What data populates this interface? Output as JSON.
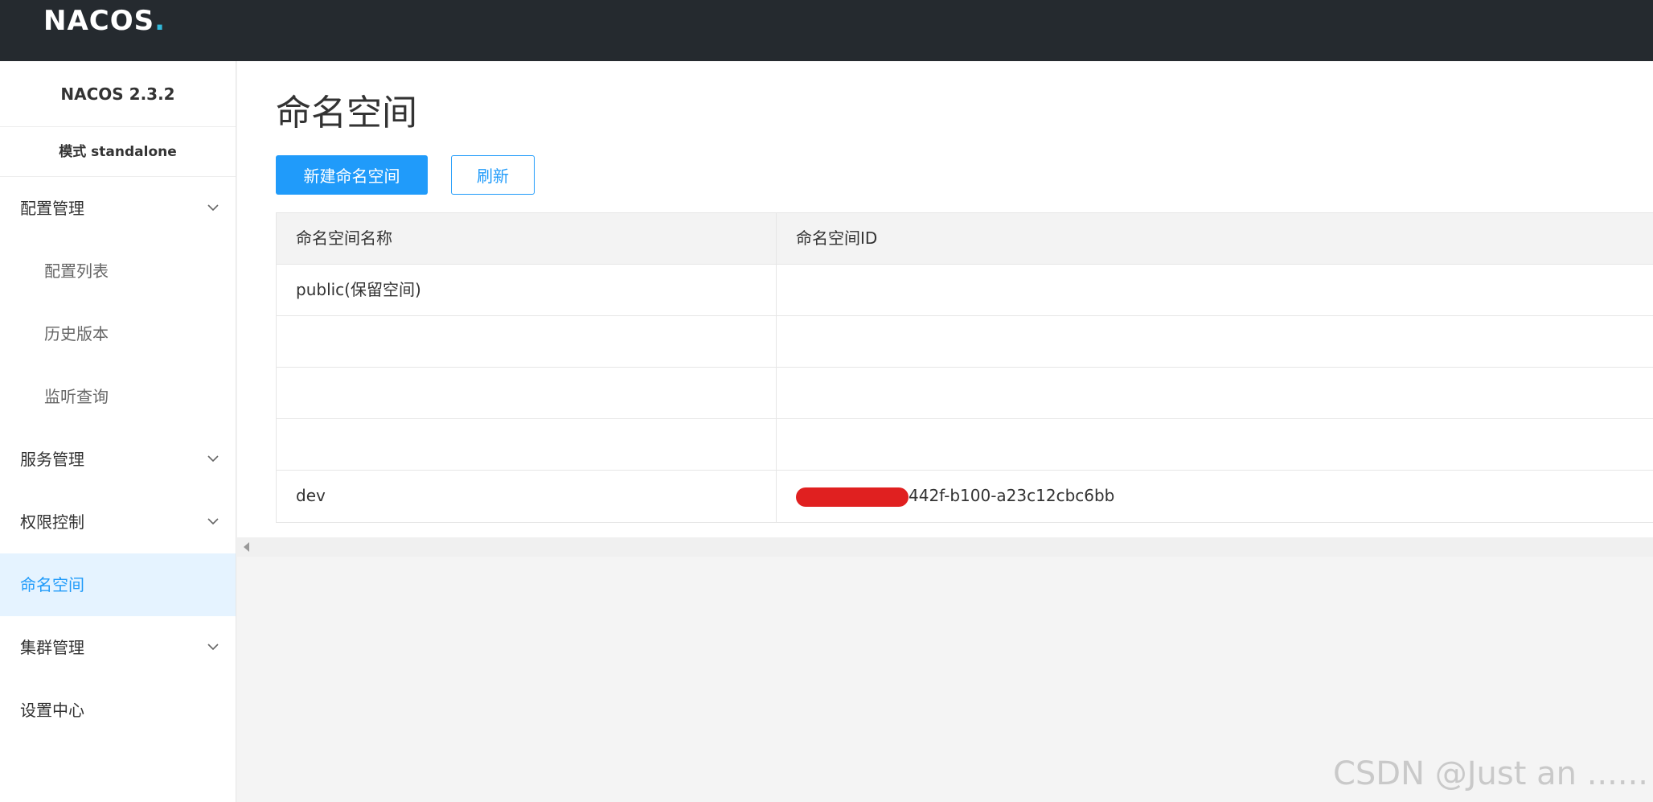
{
  "app": {
    "logo_text": "NACOS",
    "logo_dot": "."
  },
  "sidebar": {
    "version": "NACOS 2.3.2",
    "mode": "模式 standalone",
    "items": [
      {
        "label": "配置管理",
        "expandable": true
      },
      {
        "label": "配置列表",
        "sub": true
      },
      {
        "label": "历史版本",
        "sub": true
      },
      {
        "label": "监听查询",
        "sub": true
      },
      {
        "label": "服务管理",
        "expandable": true
      },
      {
        "label": "权限控制",
        "expandable": true
      },
      {
        "label": "命名空间",
        "active": true
      },
      {
        "label": "集群管理",
        "expandable": true
      },
      {
        "label": "设置中心"
      }
    ]
  },
  "main": {
    "title": "命名空间",
    "new_button": "新建命名空间",
    "refresh_button": "刷新",
    "table": {
      "columns": [
        "命名空间名称",
        "命名空间ID"
      ],
      "rows": [
        {
          "name": "public(保留空间)",
          "id": ""
        },
        {
          "name": "",
          "id": ""
        },
        {
          "name": "",
          "id": ""
        },
        {
          "name": "",
          "id": ""
        },
        {
          "name": "dev",
          "id": "442f-b100-a23c12cbc6bb"
        }
      ]
    }
  },
  "watermark": "CSDN @Just an ......",
  "colors": {
    "accent": "#209bfa",
    "topbar": "#252a2f",
    "active_bg": "#e5f3ff",
    "redaction": "#e02020"
  }
}
